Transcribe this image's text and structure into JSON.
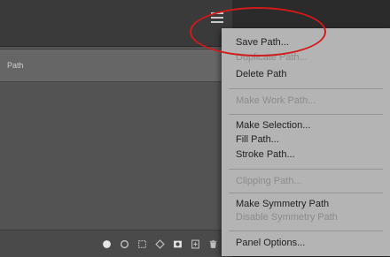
{
  "panel": {
    "path_name": "Path",
    "footer_icons": [
      "fill-path-icon",
      "stroke-path-icon",
      "load-selection-icon",
      "make-work-path-icon",
      "add-mask-icon",
      "new-path-icon",
      "delete-path-icon"
    ]
  },
  "menu": {
    "items": [
      {
        "label": "Save Path...",
        "enabled": true
      },
      {
        "label": "Duplicate Path...",
        "enabled": false
      },
      {
        "label": "Delete Path",
        "enabled": true
      },
      {
        "label": "Make Work Path...",
        "enabled": false
      },
      {
        "label": "Make Selection...",
        "enabled": true
      },
      {
        "label": "Fill Path...",
        "enabled": true
      },
      {
        "label": "Stroke Path...",
        "enabled": true
      },
      {
        "label": "Clipping Path...",
        "enabled": false
      },
      {
        "label": "Make Symmetry Path",
        "enabled": true
      },
      {
        "label": "Disable Symmetry Path",
        "enabled": false
      },
      {
        "label": "Panel Options...",
        "enabled": true
      }
    ]
  },
  "colors": {
    "annotation_ring": "#d11a1a",
    "menu_background": "#b4b4b4",
    "panel_background": "#535353"
  }
}
